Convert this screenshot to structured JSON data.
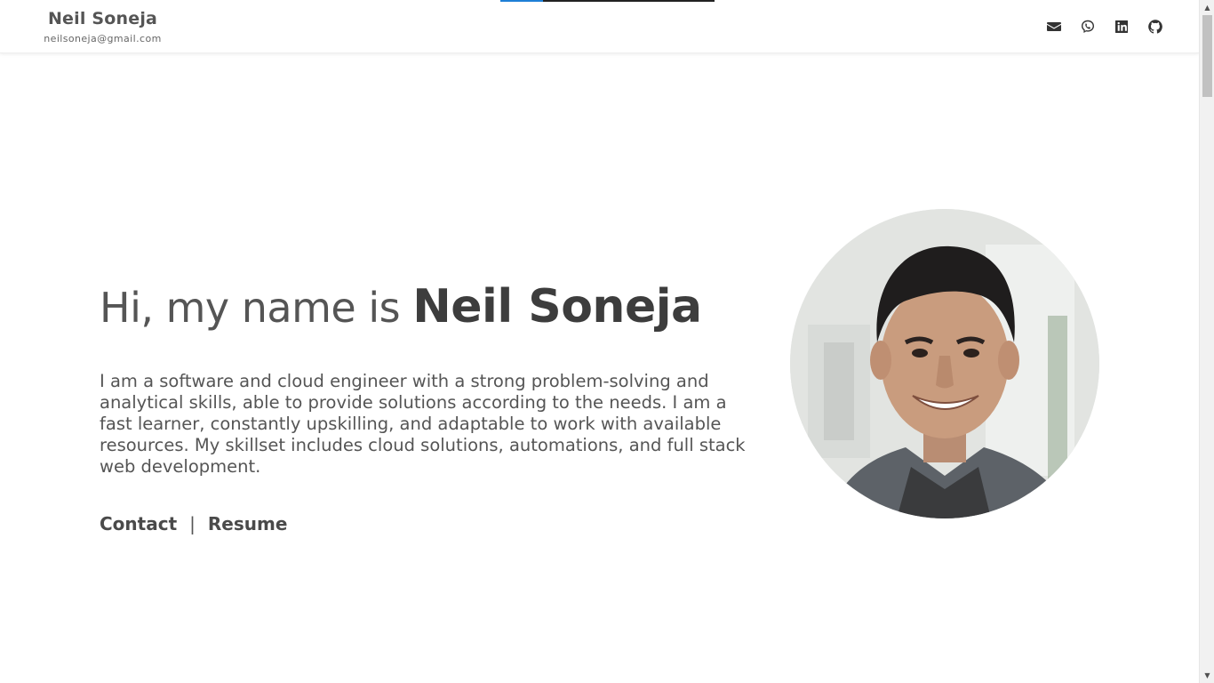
{
  "header": {
    "brand_name": "Neil Soneja",
    "brand_email": "neilsoneja@gmail.com",
    "scroll_progress": 0.2,
    "social_icons": [
      "envelope-icon",
      "viber-icon",
      "linkedin-icon",
      "github-icon"
    ]
  },
  "hero": {
    "greeting": "Hi, my name is ",
    "name": "Neil Soneja",
    "description": "I am a software and cloud engineer with a strong problem-solving and analytical skills, able to provide solutions according to the needs. I am a fast learner, constantly upskilling, and adaptable to work with available resources. My skillset includes cloud solutions, automations, and full stack web development.",
    "contact_label": "Contact",
    "separator": "|",
    "resume_label": "Resume"
  },
  "colors": {
    "accent": "#1e7fd6",
    "text": "#555555"
  }
}
